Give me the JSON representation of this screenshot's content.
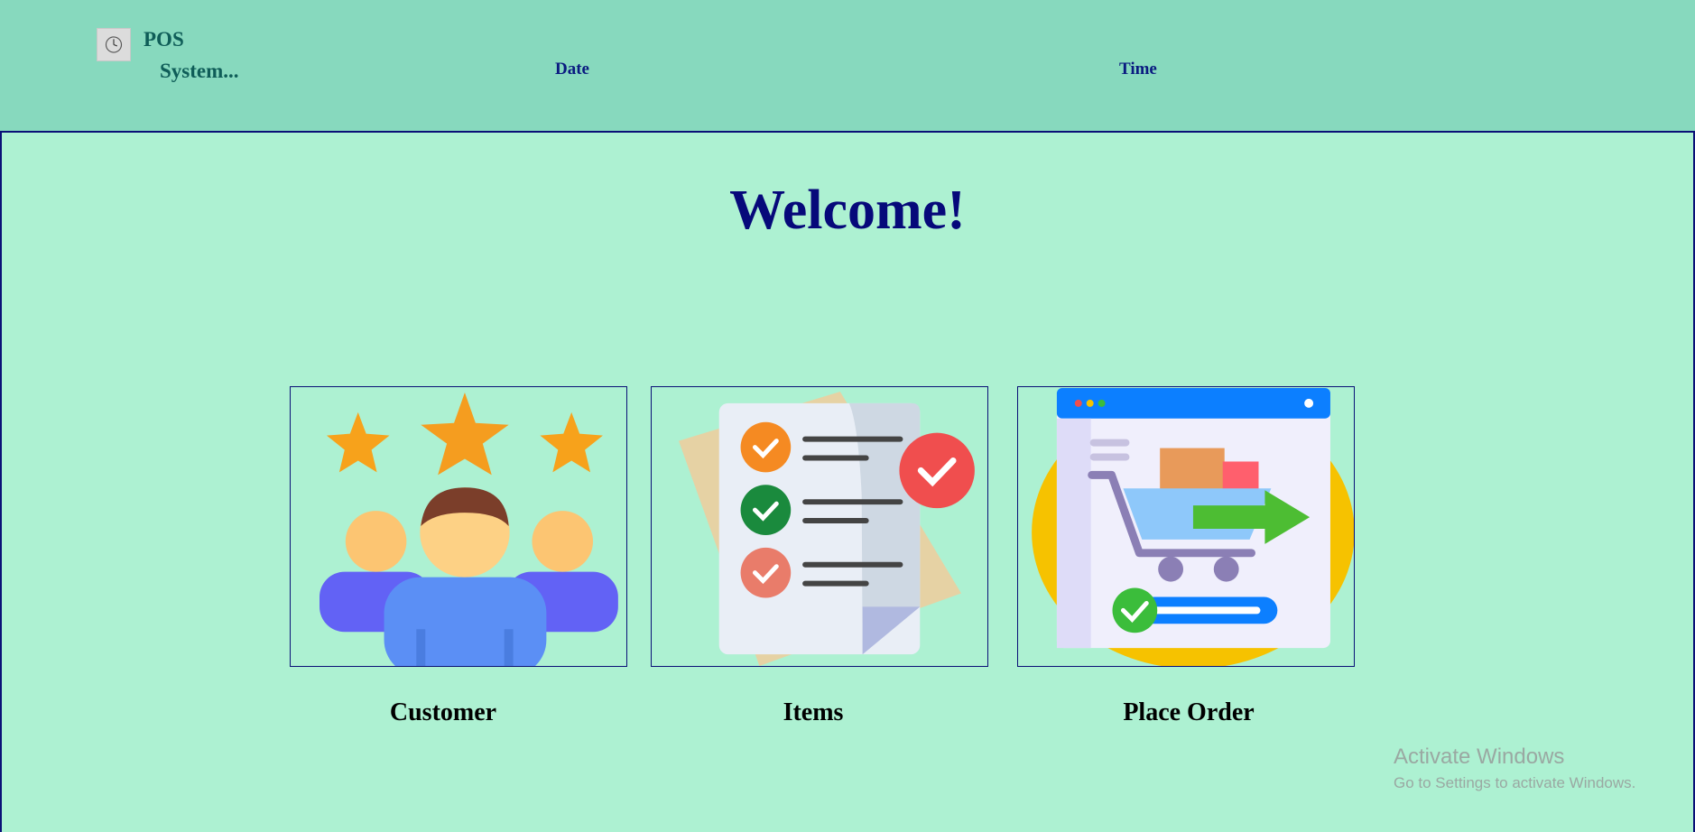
{
  "header": {
    "brand_line1": "POS",
    "brand_line2": "System...",
    "date_label": "Date",
    "time_label": "Time"
  },
  "main": {
    "welcome": "Welcome!",
    "cards": [
      {
        "label": "Customer",
        "icon": "customers-rating-icon"
      },
      {
        "label": "Items",
        "icon": "checklist-icon"
      },
      {
        "label": "Place Order",
        "icon": "shopping-cart-order-icon"
      }
    ]
  },
  "watermark": {
    "title": "Activate Windows",
    "subtitle": "Go to Settings to activate Windows."
  },
  "colors": {
    "header_bg": "#87d9be",
    "page_bg": "#adf1d2",
    "heading": "#06097a",
    "border": "#0a1077"
  }
}
